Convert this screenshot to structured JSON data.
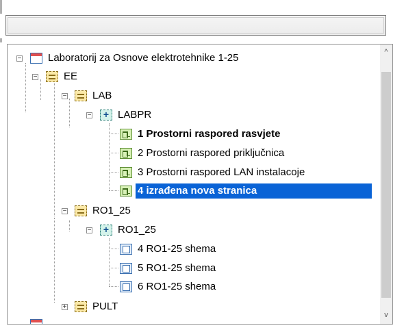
{
  "path_field": {
    "value": ""
  },
  "tree": {
    "root": {
      "label": "Laboratorij za Osnove elektrotehnike 1-25",
      "expanded": true,
      "icon": "project-icon"
    },
    "ee": {
      "label": "EE",
      "expanded": true,
      "icon": "folder-icon"
    },
    "lab": {
      "label": "LAB",
      "expanded": true,
      "icon": "folder-icon"
    },
    "labpr": {
      "label": "LABPR",
      "expanded": true,
      "icon": "group-icon"
    },
    "labpr_pages": [
      {
        "label": "1 Prostorni raspored rasvjete",
        "bold": true,
        "selected": false,
        "icon": "page-icon"
      },
      {
        "label": "2 Prostorni raspored priključnica",
        "bold": false,
        "selected": false,
        "icon": "page-icon"
      },
      {
        "label": "3 Prostorni raspored LAN instalacoje",
        "bold": false,
        "selected": false,
        "icon": "page-icon"
      },
      {
        "label": "4 izrađena nova stranica",
        "bold": true,
        "selected": true,
        "icon": "page-icon"
      }
    ],
    "ro1_25_folder": {
      "label": "RO1_25",
      "expanded": true,
      "icon": "folder-icon"
    },
    "ro1_25_group": {
      "label": "RO1_25",
      "expanded": true,
      "icon": "group-icon"
    },
    "ro1_25_pages": [
      {
        "label": "4 RO1-25 shema",
        "icon": "schema-icon"
      },
      {
        "label": "5 RO1-25 shema",
        "icon": "schema-icon"
      },
      {
        "label": "6 RO1-25 shema",
        "icon": "schema-icon"
      }
    ],
    "pult": {
      "label": "PULT",
      "expanded": false,
      "icon": "folder-icon"
    }
  },
  "scrollbar": {
    "up_arrow": "^",
    "down_arrow": "v"
  },
  "colors": {
    "selection": "#0a63d6",
    "selection_text": "#ffffff"
  }
}
